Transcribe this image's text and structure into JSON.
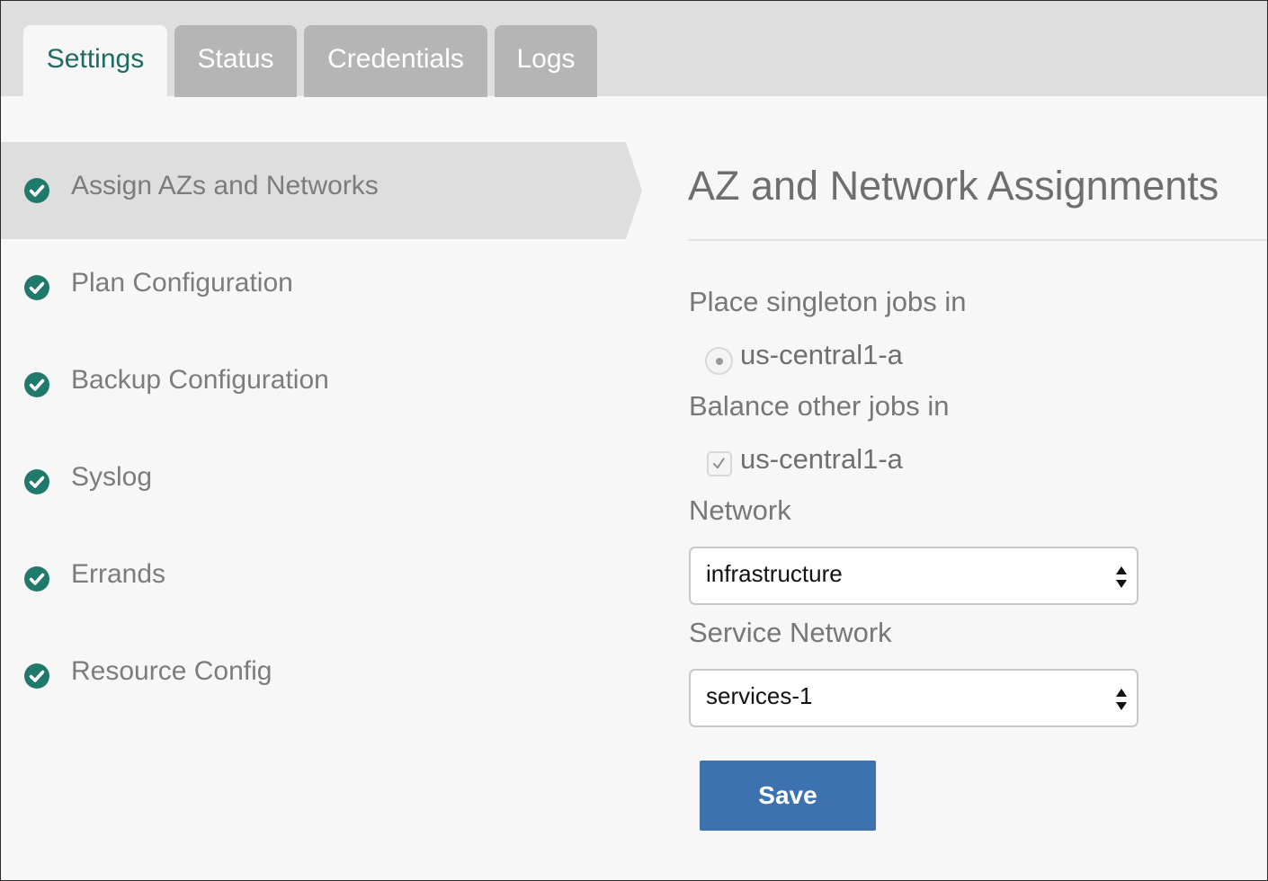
{
  "tabs": [
    {
      "label": "Settings",
      "active": true
    },
    {
      "label": "Status",
      "active": false
    },
    {
      "label": "Credentials",
      "active": false
    },
    {
      "label": "Logs",
      "active": false
    }
  ],
  "sidebar": {
    "items": [
      {
        "label": "Assign AZs and Networks",
        "icon": "check-circle-icon",
        "active": true
      },
      {
        "label": "Plan Configuration",
        "icon": "check-circle-icon",
        "active": false
      },
      {
        "label": "Backup Configuration",
        "icon": "check-circle-icon",
        "active": false
      },
      {
        "label": "Syslog",
        "icon": "check-circle-icon",
        "active": false
      },
      {
        "label": "Errands",
        "icon": "check-circle-icon",
        "active": false
      },
      {
        "label": "Resource Config",
        "icon": "check-circle-icon",
        "active": false
      }
    ]
  },
  "panel": {
    "title": "AZ and Network Assignments",
    "singleton": {
      "label": "Place singleton jobs in",
      "option": "us-central1-a",
      "selected": true
    },
    "balance": {
      "label": "Balance other jobs in",
      "option": "us-central1-a",
      "checked": true
    },
    "network": {
      "label": "Network",
      "value": "infrastructure"
    },
    "service_network": {
      "label": "Service Network",
      "value": "services-1"
    },
    "save_label": "Save"
  },
  "colors": {
    "accent_green": "#1f7a6b",
    "tab_active_text": "#1f6b63",
    "tab_inactive_bg": "#b5b5b5",
    "save_button": "#3c72b0",
    "sidebar_active_bg": "#dedede"
  }
}
